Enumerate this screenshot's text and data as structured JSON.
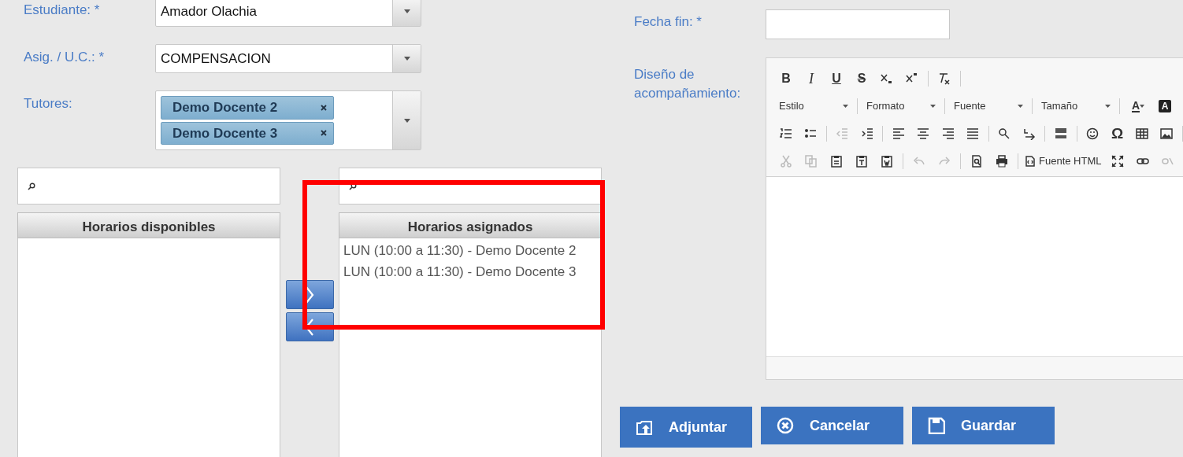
{
  "form": {
    "fields": [
      {
        "label": "Estudiante: *",
        "kind": "select",
        "value": "Amador Olachia"
      },
      {
        "label": "Asig. / U.C.: *",
        "kind": "select",
        "value": "COMPENSACION"
      },
      {
        "label": "Tutores:",
        "kind": "multiselect",
        "tags": [
          "Demo Docente 2",
          "Demo Docente 3"
        ]
      }
    ]
  },
  "available": {
    "title": "Horarios disponibles"
  },
  "assigned": {
    "title": "Horarios asignados",
    "items": [
      "LUN (10:00 a 11:30) - Demo Docente 2",
      "LUN (10:00 a 11:30) - Demo Docente 3"
    ]
  },
  "highlight": true,
  "end_date": {
    "label": "Fecha fin: *"
  },
  "editor": {
    "label": "Diseño de acompañamiento:",
    "toolbar": [
      [
        {
          "kind": "bold",
          "text": "B"
        },
        {
          "kind": "italic",
          "text": "I"
        },
        {
          "kind": "underline",
          "text": "U"
        },
        {
          "kind": "strike",
          "text": "S"
        },
        {
          "kind": "icon",
          "disabled": false
        },
        {
          "kind": "icon",
          "disabled": false
        },
        {
          "kind": "sep"
        },
        {
          "kind": "icon",
          "disabled": false
        },
        {
          "kind": "sep"
        }
      ],
      [
        {
          "kind": "combo",
          "text": "Estilo"
        },
        {
          "kind": "sep"
        },
        {
          "kind": "combo",
          "text": "Formato"
        },
        {
          "kind": "sep"
        },
        {
          "kind": "combo",
          "text": "Fuente"
        },
        {
          "kind": "sep"
        },
        {
          "kind": "combo",
          "text": "Tamaño"
        },
        {
          "kind": "sep"
        },
        {
          "kind": "color",
          "text": "A"
        },
        {
          "kind": "boxed",
          "text": "A"
        }
      ],
      [
        {
          "kind": "icon",
          "disabled": false
        },
        {
          "kind": "icon",
          "disabled": false
        },
        {
          "kind": "sep"
        },
        {
          "kind": "icon",
          "disabled": true
        },
        {
          "kind": "icon",
          "disabled": false
        },
        {
          "kind": "sep"
        },
        {
          "kind": "icon",
          "disabled": false
        },
        {
          "kind": "icon",
          "disabled": false
        },
        {
          "kind": "icon",
          "disabled": false
        },
        {
          "kind": "icon",
          "disabled": false
        },
        {
          "kind": "sep"
        },
        {
          "kind": "icon",
          "disabled": false
        },
        {
          "kind": "icon",
          "disabled": false
        },
        {
          "kind": "sep"
        },
        {
          "kind": "icon",
          "disabled": false
        },
        {
          "kind": "sep"
        },
        {
          "kind": "icon",
          "disabled": false
        },
        {
          "kind": "symbol",
          "text": "Ω"
        },
        {
          "kind": "icon",
          "disabled": false
        },
        {
          "kind": "icon",
          "disabled": false
        },
        {
          "kind": "sep"
        }
      ],
      [
        {
          "kind": "icon",
          "disabled": true
        },
        {
          "kind": "icon",
          "disabled": true
        },
        {
          "kind": "icon",
          "disabled": false
        },
        {
          "kind": "icon",
          "disabled": false
        },
        {
          "kind": "icon",
          "disabled": false
        },
        {
          "kind": "sep"
        },
        {
          "kind": "icon",
          "disabled": true
        },
        {
          "kind": "icon",
          "disabled": true
        },
        {
          "kind": "sep"
        },
        {
          "kind": "icon",
          "disabled": false
        },
        {
          "kind": "icon",
          "disabled": false
        },
        {
          "kind": "sep"
        },
        {
          "kind": "button",
          "text": "Fuente HTML"
        },
        {
          "kind": "icon",
          "disabled": false
        },
        {
          "kind": "icon",
          "disabled": false
        },
        {
          "kind": "icon",
          "disabled": true
        }
      ]
    ]
  },
  "actions": [
    {
      "label": "Adjuntar",
      "kind": "attach"
    },
    {
      "label": "Cancelar",
      "kind": "cancel"
    },
    {
      "label": "Guardar",
      "kind": "save"
    }
  ]
}
